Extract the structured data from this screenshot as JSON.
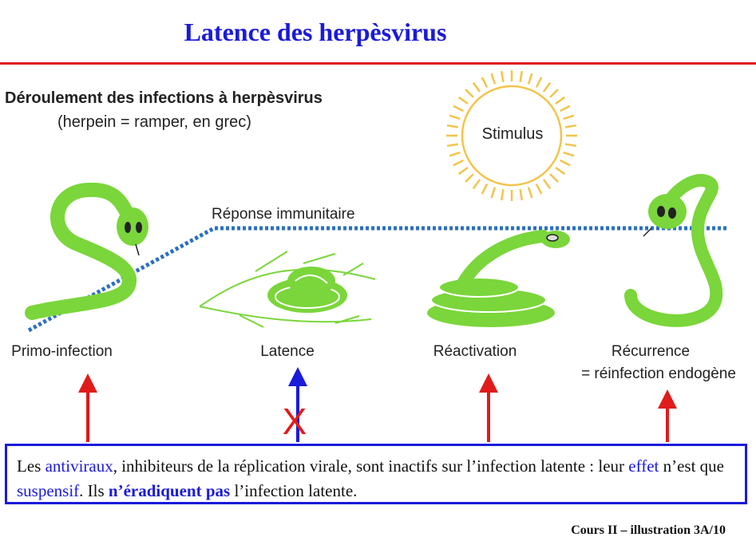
{
  "title": "Latence des herpèsvirus",
  "subtitle": "Déroulement des infections à herpèsvirus",
  "subtitle_note": "(herpein = ramper, en grec)",
  "stimulus_label": "Stimulus",
  "immune_label": "Réponse immunitaire",
  "stages": [
    {
      "label": "Primo-infection"
    },
    {
      "label": "Latence"
    },
    {
      "label": "Réactivation"
    },
    {
      "label": "Récurrence",
      "label2": "= réinfection endogène"
    }
  ],
  "blocked_marker": "X",
  "box": {
    "p1": "Les ",
    "antiviraux": "antiviraux",
    "p2": ", inhibiteurs de la réplication virale, sont inactifs sur l’infection latente : leur ",
    "effet": "effet",
    "p3": " n’est que ",
    "suspensif": "suspensif",
    "p4": ". Ils ",
    "neradiquent": "n’éradiquent pas",
    "p5": " l’infection latente."
  },
  "footer": "Cours II – illustration 3A/10",
  "colors": {
    "title_blue": "#1a1adb",
    "rule_red": "#e01b1b",
    "snake_green": "#7ad63a",
    "sun_yellow": "#f2c44a",
    "dotted_blue": "#2a6fc0",
    "arrow_red": "#e01b1b"
  }
}
